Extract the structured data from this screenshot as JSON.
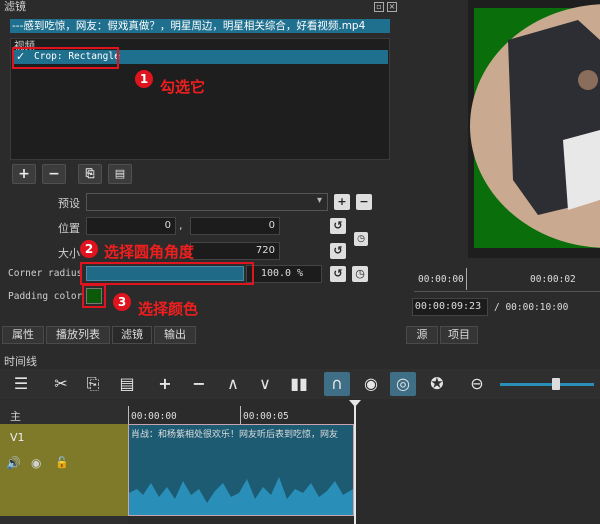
{
  "panel": {
    "title": "滤镜",
    "filename": "---感到吃惊，网友：假戏真做？，明星周边，明星相关综合，好看视频.mp4",
    "group": "视频",
    "filter_item": "Crop: Rectangle"
  },
  "controls": {
    "preset_label": "预设",
    "position_label": "位置",
    "position_x": "0",
    "position_sep": ",",
    "position_y": "0",
    "size_label": "大小",
    "size_h": "720",
    "corner_label": "Corner radius",
    "corner_value": "100.0 %",
    "padding_label": "Padding color",
    "padding_color": "#0a5a0a"
  },
  "annotations": {
    "a1_num": "1",
    "a1_text": "勾选它",
    "a2_num": "2",
    "a2_text": "选择圆角角度",
    "a3_num": "3",
    "a3_text": "选择颜色"
  },
  "tabs": [
    "属性",
    "播放列表",
    "滤镜",
    "输出"
  ],
  "right_tabs": [
    "源",
    "项目"
  ],
  "player": {
    "ruler_0": "00:00:00",
    "ruler_1": "00:00:02",
    "timecode": "00:00:09:23",
    "duration": "/ 00:00:10:00"
  },
  "timeline": {
    "title": "时间线",
    "track_main": "主",
    "track_v1": "V1",
    "ruler_0": "00:00:00",
    "ruler_1": "00:00:05",
    "clip_caption": "肖战：和杨紫相处很欢乐！网友听后表到吃惊，网友"
  },
  "colors": {
    "accent": "#1f6f8e",
    "annotation_red": "#e0141e",
    "preview_green": "#0a6e0a",
    "waveform": "#2a8fb8"
  }
}
